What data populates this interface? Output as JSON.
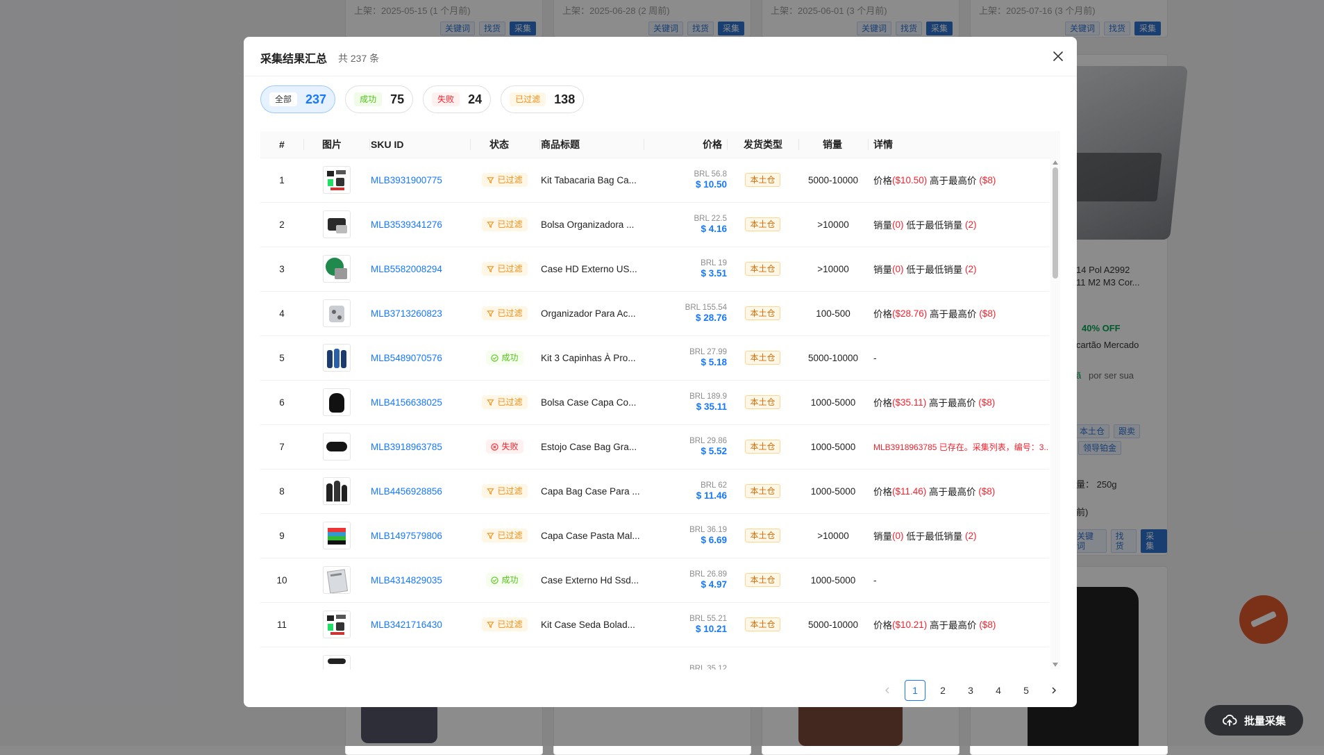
{
  "background": {
    "cards": [
      {
        "date": "上架：2025-05-15 (1 个月前)"
      },
      {
        "date": "上架：2025-06-28 (2 周前)"
      },
      {
        "date": "上架：2025-06-01 (3 个月前)"
      },
      {
        "date": "上架：2025-07-16 (3 个月前)"
      }
    ],
    "card_buttons": {
      "keywords": "关键词",
      "find": "找货",
      "collect": "采集"
    },
    "side_card": {
      "title_line1": "14 Pol A2992",
      "title_line2": "11 M2 M3 Cor...",
      "discount": "40% OFF",
      "payment": "cartão Mercado",
      "promo_prefix": "ã",
      "promo_text": "por ser sua",
      "tag_local": "本土仓",
      "tag_follow": "跟卖",
      "tag_gold": "领导铂金",
      "weight": "量：  250g",
      "date_suffix": "前)"
    },
    "batch_button_label": "批量采集"
  },
  "modal": {
    "title": "采集结果汇总",
    "count_text": "共 237 条",
    "filters": [
      {
        "label": "全部",
        "count": "237",
        "active": true,
        "tone": "all"
      },
      {
        "label": "成功",
        "count": "75",
        "active": false,
        "tone": "success"
      },
      {
        "label": "失败",
        "count": "24",
        "active": false,
        "tone": "fail"
      },
      {
        "label": "已过滤",
        "count": "138",
        "active": false,
        "tone": "filtered"
      }
    ],
    "columns": {
      "index": "#",
      "image": "图片",
      "sku": "SKU ID",
      "status": "状态",
      "title": "商品标题",
      "price": "价格",
      "ship": "发货类型",
      "sales": "销量",
      "detail": "详情"
    },
    "rows": [
      {
        "index": "1",
        "sku": "MLB3931900775",
        "status": "已过滤",
        "status_type": "filtered",
        "title": "Kit Tabacaria Bag Ca...",
        "brl": "BRL 56.8",
        "usd": "$ 10.50",
        "ship": "本土仓",
        "sales": "5000-10000",
        "detail": {
          "a": "价格",
          "b": "($10.50)",
          "c": " 高于最高价 ",
          "d": "($8)"
        },
        "thumb": "kit"
      },
      {
        "index": "2",
        "sku": "MLB3539341276",
        "status": "已过滤",
        "status_type": "filtered",
        "title": "Bolsa Organizadora ...",
        "brl": "BRL 22.5",
        "usd": "$ 4.16",
        "ship": "本土仓",
        "sales": ">10000",
        "detail": {
          "a": "销量",
          "b": "(0)",
          "c": " 低于最低销量 ",
          "d": "(2)"
        },
        "thumb": "bag"
      },
      {
        "index": "3",
        "sku": "MLB5582008294",
        "status": "已过滤",
        "status_type": "filtered",
        "title": "Case HD Externo US...",
        "brl": "BRL 19",
        "usd": "$ 3.51",
        "ship": "本土仓",
        "sales": ">10000",
        "detail": {
          "a": "销量",
          "b": "(0)",
          "c": " 低于最低销量 ",
          "d": "(2)"
        },
        "thumb": "green"
      },
      {
        "index": "4",
        "sku": "MLB3713260823",
        "status": "已过滤",
        "status_type": "filtered",
        "title": "Organizador Para Ac...",
        "brl": "BRL 155.54",
        "usd": "$ 28.76",
        "ship": "本土仓",
        "sales": "100-500",
        "detail": {
          "a": "价格",
          "b": "($28.76)",
          "c": " 高于最高价 ",
          "d": "($8)"
        },
        "thumb": "grey"
      },
      {
        "index": "5",
        "sku": "MLB5489070576",
        "status": "成功",
        "status_type": "success",
        "title": "Kit 3 Capinhas À Pro...",
        "brl": "BRL 27.99",
        "usd": "$ 5.18",
        "ship": "本土仓",
        "sales": "5000-10000",
        "detail": {
          "a": "-",
          "b": "",
          "c": "",
          "d": ""
        },
        "thumb": "bottles"
      },
      {
        "index": "6",
        "sku": "MLB4156638025",
        "status": "已过滤",
        "status_type": "filtered",
        "title": "Bolsa Case Capa Co...",
        "brl": "BRL 189.9",
        "usd": "$ 35.11",
        "ship": "本土仓",
        "sales": "1000-5000",
        "detail": {
          "a": "价格",
          "b": "($35.11)",
          "c": " 高于最高价 ",
          "d": "($8)"
        },
        "thumb": "black"
      },
      {
        "index": "7",
        "sku": "MLB3918963785",
        "status": "失败",
        "status_type": "fail",
        "title": "Estojo Case Bag Gra...",
        "brl": "BRL 29.86",
        "usd": "$ 5.52",
        "ship": "本土仓",
        "sales": "1000-5000",
        "detail": {
          "error": "MLB3918963785 已存在。采集列表，编号：3..."
        },
        "thumb": "case"
      },
      {
        "index": "8",
        "sku": "MLB4456928856",
        "status": "已过滤",
        "status_type": "filtered",
        "title": "Capa Bag Case Para ...",
        "brl": "BRL 62",
        "usd": "$ 11.46",
        "ship": "本土仓",
        "sales": "1000-5000",
        "detail": {
          "a": "价格",
          "b": "($11.46)",
          "c": " 高于最高价 ",
          "d": "($8)"
        },
        "thumb": "cones"
      },
      {
        "index": "9",
        "sku": "MLB1497579806",
        "status": "已过滤",
        "status_type": "filtered",
        "title": "Capa Case Pasta Mal...",
        "brl": "BRL 36.19",
        "usd": "$ 6.69",
        "ship": "本土仓",
        "sales": ">10000",
        "detail": {
          "a": "销量",
          "b": "(0)",
          "c": " 低于最低销量 ",
          "d": "(2)"
        },
        "thumb": "colors"
      },
      {
        "index": "10",
        "sku": "MLB4314829035",
        "status": "成功",
        "status_type": "success",
        "title": "Case Externo Hd Ssd...",
        "brl": "BRL 26.89",
        "usd": "$ 4.97",
        "ship": "本土仓",
        "sales": "1000-5000",
        "detail": {
          "a": "-",
          "b": "",
          "c": "",
          "d": ""
        },
        "thumb": "hd"
      },
      {
        "index": "11",
        "sku": "MLB3421716430",
        "status": "已过滤",
        "status_type": "filtered",
        "title": "Kit Case Seda Bolad...",
        "brl": "BRL 55.21",
        "usd": "$ 10.21",
        "ship": "本土仓",
        "sales": "5000-10000",
        "detail": {
          "a": "价格",
          "b": "($10.21)",
          "c": " 高于最高价 ",
          "d": "($8)"
        },
        "thumb": "kit"
      },
      {
        "index": "",
        "sku": "",
        "status": "",
        "status_type": "none",
        "title": "",
        "brl": "BRL 35.12",
        "usd": "",
        "ship": "",
        "sales": "",
        "detail": {
          "a": "",
          "b": "",
          "c": "",
          "d": ""
        },
        "thumb": "partial"
      }
    ],
    "pagination": {
      "pages": [
        "1",
        "2",
        "3",
        "4",
        "5"
      ],
      "current": "1"
    }
  }
}
